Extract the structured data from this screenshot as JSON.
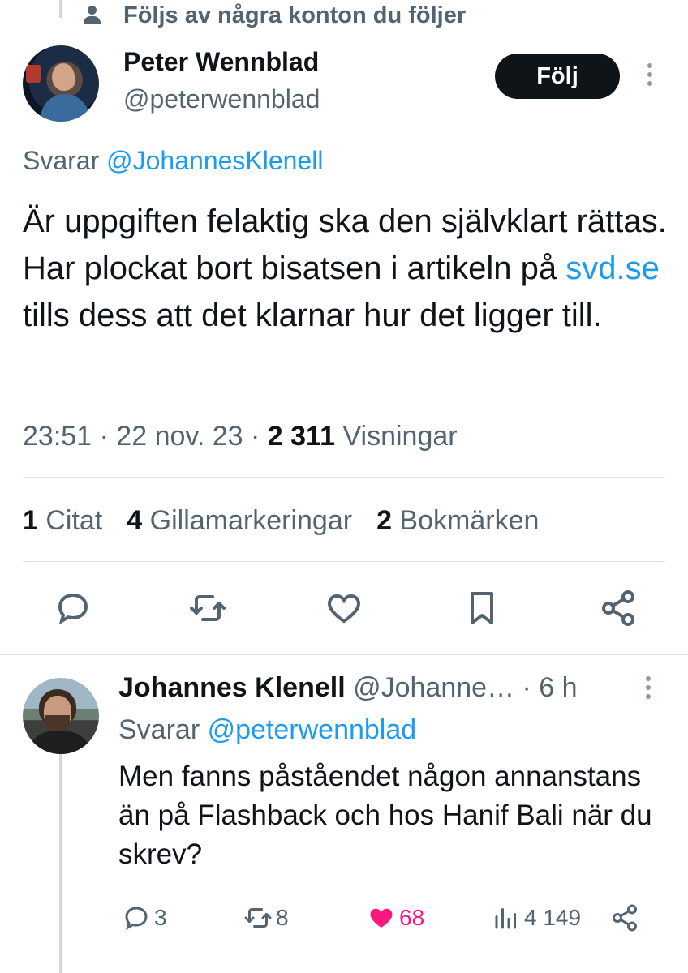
{
  "social_context": {
    "text": "Följs av några konton du följer"
  },
  "tweet": {
    "author_name": "Peter Wennblad",
    "author_handle": "@peterwennblad",
    "follow_label": "Följ",
    "replying_prefix": "Svarar ",
    "replying_to": "@JohannesKlenell",
    "text_part1": "Är uppgiften felaktig ska den självklart rättas. Har plockat bort bisatsen i artikeln på ",
    "text_link": "svd.se",
    "text_part2": " tills dess att det klarnar hur det ligger till.",
    "time": "23:51 · 22 nov. 23 · ",
    "views_count": "2 311",
    "views_label": " Visningar",
    "quotes_count": "1",
    "quotes_label": " Citat",
    "likes_count": "4",
    "likes_label": " Gillamarkeringar",
    "bookmarks_count": "2",
    "bookmarks_label": " Bokmärken",
    "action_icons": [
      "reply-icon",
      "retweet-icon",
      "like-icon",
      "bookmark-icon",
      "share-icon"
    ]
  },
  "reply": {
    "author_name": "Johannes Klenell",
    "author_handle": "@Johanne…",
    "time": " · 6 h",
    "replying_prefix": "Svarar ",
    "replying_to": "@peterwennblad",
    "text": "Men fanns påståendet någon annanstans än på Flashback och hos Hanif Bali när du skrev?",
    "replies": "3",
    "retweets": "8",
    "likes": "68",
    "views": "4 149"
  },
  "colors": {
    "accent": "#1d9bf0",
    "like": "#f91880",
    "text": "#0f1419",
    "secondary": "#536471"
  }
}
